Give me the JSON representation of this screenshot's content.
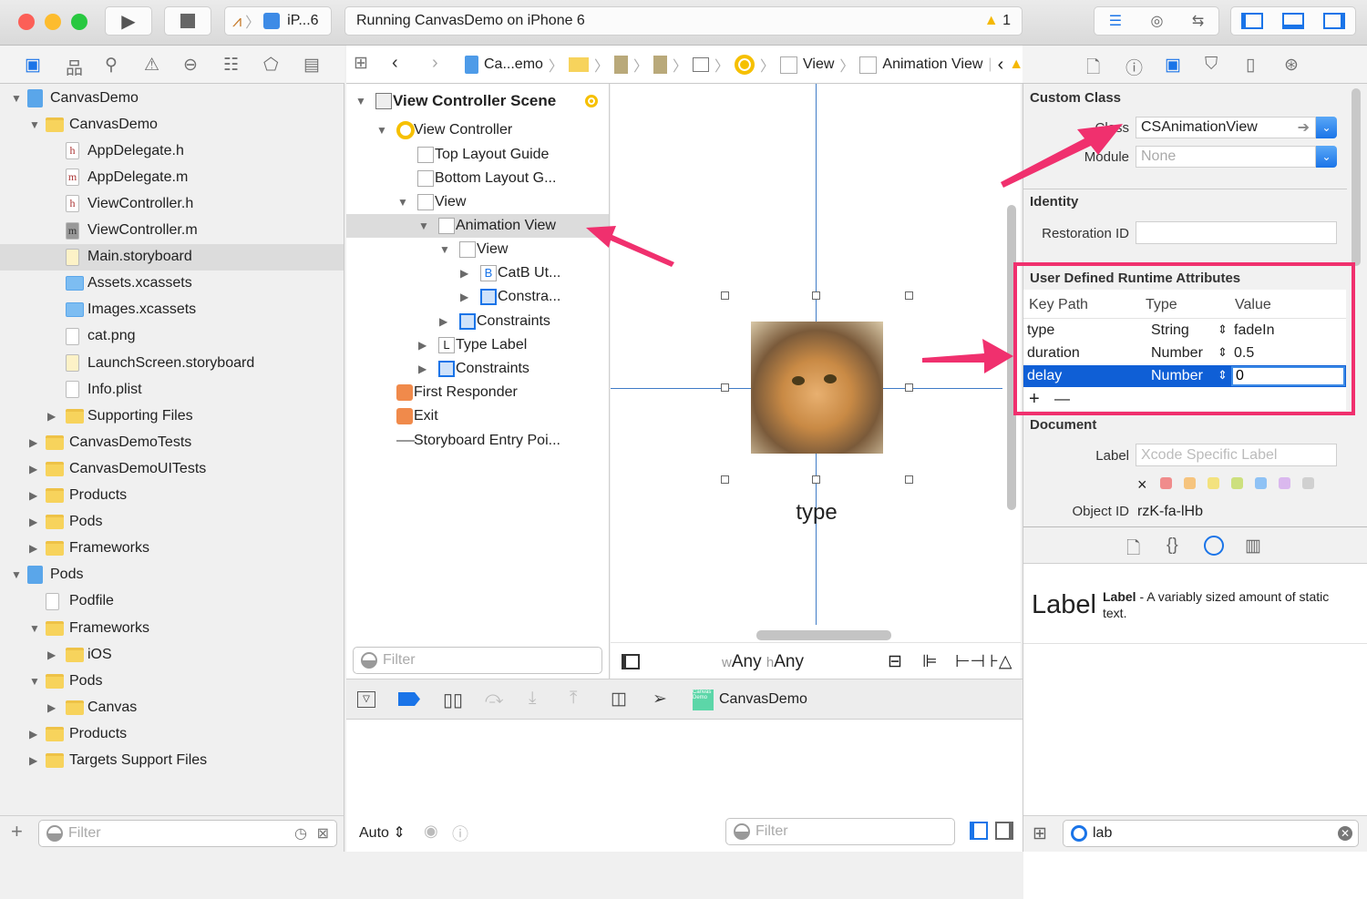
{
  "toolbar": {
    "scheme": "iP...6",
    "status": "Running CanvasDemo on iPhone 6",
    "warning_count": "1",
    "run_icon": "play-icon",
    "stop_icon": "stop-icon"
  },
  "jumpbar": {
    "items": [
      "Ca...emo",
      "View",
      "Animation View"
    ]
  },
  "navigator": {
    "items": [
      {
        "label": "CanvasDemo",
        "level": 0,
        "arrow": "open",
        "icon": "project"
      },
      {
        "label": "CanvasDemo",
        "level": 1,
        "arrow": "open",
        "icon": "folder"
      },
      {
        "label": "AppDelegate.h",
        "level": 2,
        "arrow": "",
        "icon": "h"
      },
      {
        "label": "AppDelegate.m",
        "level": 2,
        "arrow": "",
        "icon": "m"
      },
      {
        "label": "ViewController.h",
        "level": 2,
        "arrow": "",
        "icon": "h"
      },
      {
        "label": "ViewController.m",
        "level": 2,
        "arrow": "",
        "icon": "m"
      },
      {
        "label": "Main.storyboard",
        "level": 2,
        "arrow": "",
        "icon": "storyboard",
        "selected": true
      },
      {
        "label": "Assets.xcassets",
        "level": 2,
        "arrow": "",
        "icon": "assets"
      },
      {
        "label": "Images.xcassets",
        "level": 2,
        "arrow": "",
        "icon": "assets"
      },
      {
        "label": "cat.png",
        "level": 2,
        "arrow": "",
        "icon": "image"
      },
      {
        "label": "LaunchScreen.storyboard",
        "level": 2,
        "arrow": "",
        "icon": "storyboard"
      },
      {
        "label": "Info.plist",
        "level": 2,
        "arrow": "",
        "icon": "plist"
      },
      {
        "label": "Supporting Files",
        "level": 2,
        "arrow": "closed",
        "icon": "folder"
      },
      {
        "label": "CanvasDemoTests",
        "level": 1,
        "arrow": "closed",
        "icon": "folder"
      },
      {
        "label": "CanvasDemoUITests",
        "level": 1,
        "arrow": "closed",
        "icon": "folder"
      },
      {
        "label": "Products",
        "level": 1,
        "arrow": "closed",
        "icon": "folder"
      },
      {
        "label": "Pods",
        "level": 1,
        "arrow": "closed",
        "icon": "folder"
      },
      {
        "label": "Frameworks",
        "level": 1,
        "arrow": "closed",
        "icon": "folder"
      },
      {
        "label": "Pods",
        "level": 0,
        "arrow": "open",
        "icon": "project"
      },
      {
        "label": "Podfile",
        "level": 1,
        "arrow": "",
        "icon": "plist"
      },
      {
        "label": "Frameworks",
        "level": 1,
        "arrow": "open",
        "icon": "folder"
      },
      {
        "label": "iOS",
        "level": 2,
        "arrow": "closed",
        "icon": "folder"
      },
      {
        "label": "Pods",
        "level": 1,
        "arrow": "open",
        "icon": "folder"
      },
      {
        "label": "Canvas",
        "level": 2,
        "arrow": "closed",
        "icon": "folder"
      },
      {
        "label": "Products",
        "level": 1,
        "arrow": "closed",
        "icon": "folder"
      },
      {
        "label": "Targets Support Files",
        "level": 1,
        "arrow": "closed",
        "icon": "folder"
      }
    ],
    "filter_placeholder": "Filter"
  },
  "outline": {
    "items": [
      {
        "label": "View Controller Scene",
        "level": 0,
        "arrow": "open",
        "icon": "scene",
        "bold": true
      },
      {
        "label": "View Controller",
        "level": 1,
        "arrow": "open",
        "icon": "vc"
      },
      {
        "label": "Top Layout Guide",
        "level": 2,
        "arrow": "",
        "icon": "view"
      },
      {
        "label": "Bottom Layout G...",
        "level": 2,
        "arrow": "",
        "icon": "view"
      },
      {
        "label": "View",
        "level": 2,
        "arrow": "open",
        "icon": "view"
      },
      {
        "label": "Animation View",
        "level": 3,
        "arrow": "open",
        "icon": "view",
        "selected": true
      },
      {
        "label": "View",
        "level": 4,
        "arrow": "open",
        "icon": "view"
      },
      {
        "label": "CatB Ut...",
        "level": 5,
        "arrow": "closed",
        "icon": "button"
      },
      {
        "label": "Constra...",
        "level": 5,
        "arrow": "closed",
        "icon": "constraints"
      },
      {
        "label": "Constraints",
        "level": 4,
        "arrow": "closed",
        "icon": "constraints"
      },
      {
        "label": "Type Label",
        "level": 3,
        "arrow": "closed",
        "icon": "label"
      },
      {
        "label": "Constraints",
        "level": 3,
        "arrow": "closed",
        "icon": "constraints"
      },
      {
        "label": "First Responder",
        "level": 1,
        "arrow": "",
        "icon": "responder"
      },
      {
        "label": "Exit",
        "level": 1,
        "arrow": "",
        "icon": "exit"
      },
      {
        "label": "Storyboard Entry Poi...",
        "level": 1,
        "arrow": "",
        "icon": "entry"
      }
    ],
    "filter_placeholder": "Filter"
  },
  "canvas": {
    "label_text": "type",
    "size_class_w_prefix": "w",
    "size_class_w": "Any",
    "size_class_h_prefix": "h",
    "size_class_h": "Any"
  },
  "debug": {
    "app_name": "CanvasDemo",
    "app_icon_text": "Canvas Demo"
  },
  "console": {
    "mode": "Auto",
    "filter_placeholder": "Filter"
  },
  "inspector": {
    "custom_class": {
      "title": "Custom Class",
      "class_label": "Class",
      "class_value": "CSAnimationView",
      "module_label": "Module",
      "module_placeholder": "None"
    },
    "identity": {
      "title": "Identity",
      "restoration_label": "Restoration ID",
      "restoration_value": ""
    },
    "runtime": {
      "title": "User Defined Runtime Attributes",
      "columns": [
        "Key Path",
        "Type",
        "Value"
      ],
      "rows": [
        {
          "key": "type",
          "type": "String",
          "value": "fadeIn"
        },
        {
          "key": "duration",
          "type": "Number",
          "value": "0.5"
        },
        {
          "key": "delay",
          "type": "Number",
          "value": "0",
          "selected": true
        }
      ],
      "add": "+",
      "remove": "—"
    },
    "document": {
      "title": "Document",
      "label_label": "Label",
      "label_placeholder": "Xcode Specific Label",
      "clear": "×",
      "object_id_label": "Object ID",
      "object_id": "rzK-fa-lHb",
      "colors": [
        "#f08c8c",
        "#f6c47e",
        "#f3e27e",
        "#cde07e",
        "#8fc2f5",
        "#dab8ee",
        "#d0d0d0"
      ]
    },
    "library": {
      "big": "Label",
      "name": "Label",
      "desc": " - A variably sized amount of static text."
    },
    "search_value": "lab"
  },
  "colors": {
    "accent": "#1a74e8",
    "annotation": "#f0306e",
    "selection": "#0f5fd6"
  }
}
